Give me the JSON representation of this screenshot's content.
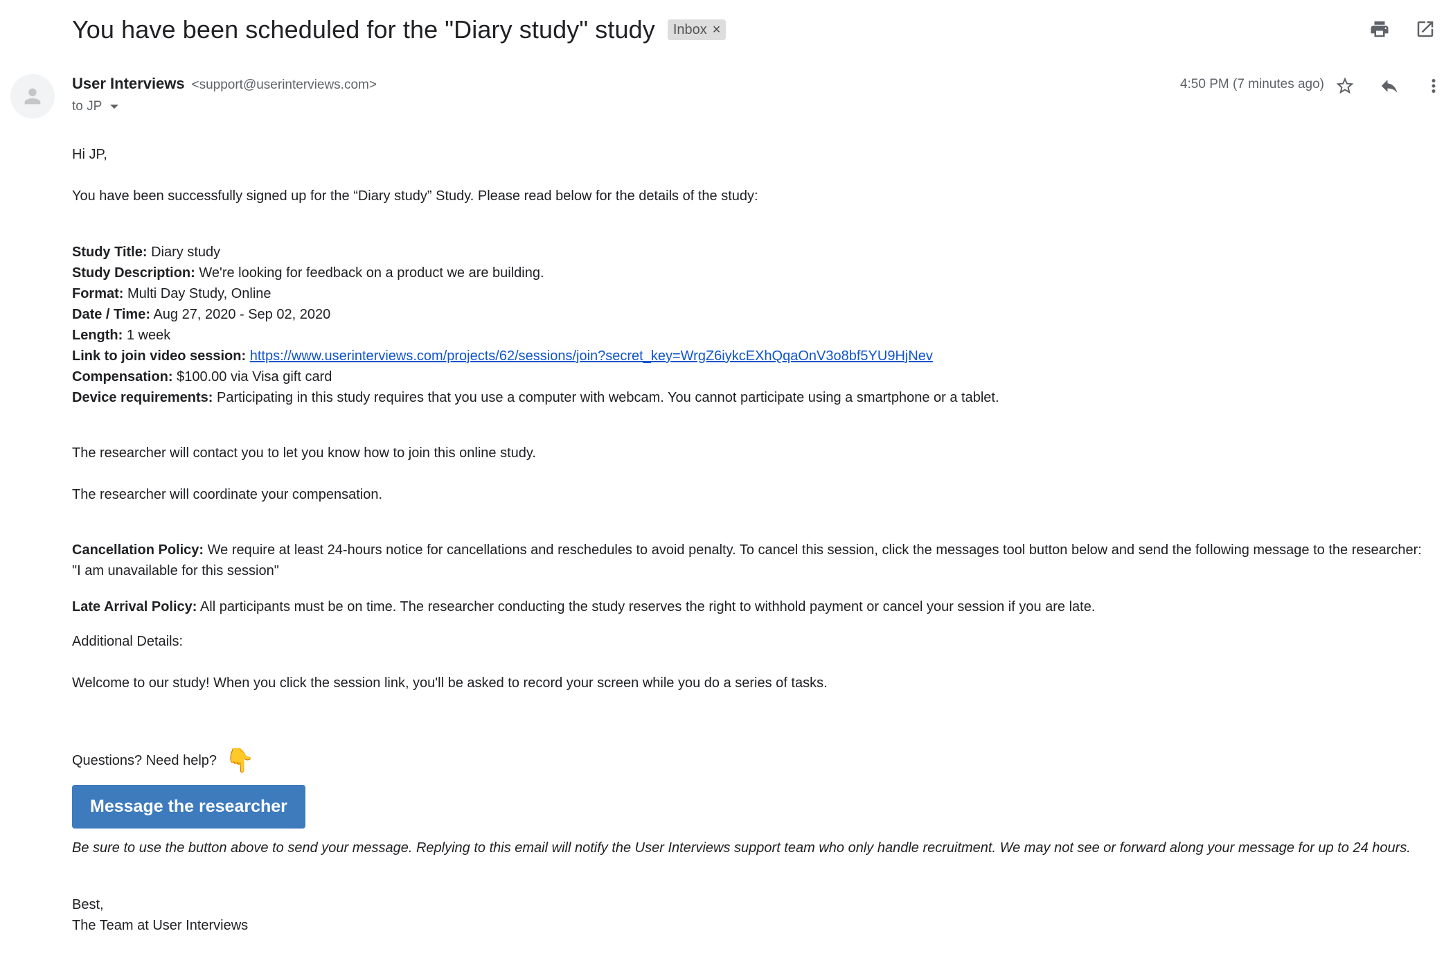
{
  "email": {
    "subject": "You have been scheduled for the \"Diary study\" study",
    "label": "Inbox",
    "label_close": "×",
    "sender_name": "User Interviews",
    "sender_email": "<support@userinterviews.com>",
    "recipient": "to JP",
    "timestamp": "4:50 PM (7 minutes ago)",
    "icons": [
      "print-icon",
      "open-in-new-window-icon",
      "star-icon",
      "reply-icon",
      "more-vert-icon",
      "avatar-person-icon"
    ]
  },
  "body": {
    "greeting": "Hi JP,",
    "intro": "You have been successfully signed up for the “Diary study” Study. Please read below for the details of the study:",
    "details": [
      {
        "label": "Study Title:",
        "value": "Diary study"
      },
      {
        "label": "Study Description:",
        "value": "We're looking for feedback on a product we are building."
      },
      {
        "label": "Format:",
        "value": "Multi Day Study, Online"
      },
      {
        "label": "Date / Time:",
        "value": "Aug 27, 2020 - Sep 02, 2020"
      },
      {
        "label": "Length:",
        "value": "1 week"
      },
      {
        "label": "Link to join video session:",
        "value": "https://www.userinterviews.com/projects/62/sessions/join?secret_key=WrgZ6iykcEXhQqaOnV3o8bf5YU9HjNev"
      },
      {
        "label": "Compensation:",
        "value": "$100.00 via Visa gift card"
      },
      {
        "label": "Device requirements:",
        "value": "Participating in this study requires that you use a computer with webcam. You cannot participate using a smartphone or a tablet."
      }
    ],
    "contact_note": "The researcher will contact you to let you know how to join this online study.",
    "compensation_note": "The researcher will coordinate your compensation.",
    "cancellation_label": "Cancellation Policy:",
    "cancellation_text": "We require at least 24-hours notice for cancellations and reschedules to avoid penalty. To cancel this session, click the messages tool button below and send the following message to the researcher: \"I am unavailable for this session\"",
    "late_label": "Late Arrival Policy:",
    "late_text": "All participants must be on time. The researcher conducting the study reserves the right to withhold payment or cancel your session if you are late.",
    "additional_label": "Additional Details:",
    "welcome": "Welcome to our study! When you click the session link, you'll be asked to record your screen while you do a series of tasks.",
    "questions": "Questions? Need help?",
    "questions_emoji": "👇",
    "cta_label": "Message the researcher",
    "disclaimer": "Be sure to use the button above to send your message. Replying to this email will notify the User Interviews support team who only handle recruitment. We may not see or forward along your message for up to 24 hours.",
    "signoff": "Best,",
    "signature": "The Team at User Interviews"
  },
  "colors": {
    "link": "#1155cc",
    "cta": "#3d7bbd",
    "muted": "#5f6368",
    "chip": "#dddddd"
  }
}
